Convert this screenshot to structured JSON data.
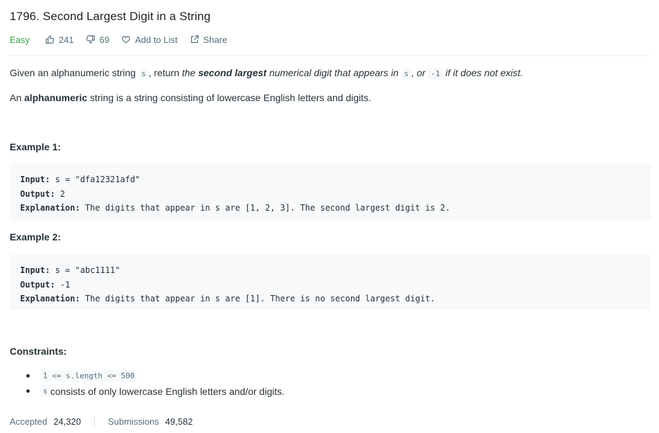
{
  "problem": {
    "title": "1796. Second Largest Digit in a String",
    "difficulty": "Easy",
    "likes": "241",
    "dislikes": "69",
    "add_to_list": "Add to List",
    "share": "Share"
  },
  "description": {
    "p1_a": "Given an alphanumeric string ",
    "p1_code_s": "s",
    "p1_b": ", return ",
    "p1_c": "the ",
    "p1_bold": "second largest",
    "p1_d": " numerical digit that appears in ",
    "p1_code_s2": "s",
    "p1_e": ", or ",
    "p1_code_neg": "-1",
    "p1_f": " if it does not exist.",
    "p2_a": "An ",
    "p2_bold": "alphanumeric",
    "p2_b": " string is a string consisting of lowercase English letters and digits."
  },
  "examples": [
    {
      "heading": "Example 1:",
      "input_label": "Input:",
      "input_value": " s = \"dfa12321afd\"",
      "output_label": "Output:",
      "output_value": " 2",
      "explanation_label": "Explanation:",
      "explanation_value": " The digits that appear in s are [1, 2, 3]. The second largest digit is 2."
    },
    {
      "heading": "Example 2:",
      "input_label": "Input:",
      "input_value": " s = \"abc1111\"",
      "output_label": "Output:",
      "output_value": " -1",
      "explanation_label": "Explanation:",
      "explanation_value": " The digits that appear in s are [1]. There is no second largest digit."
    }
  ],
  "constraints": {
    "heading": "Constraints:",
    "c1_code": "1 <= s.length <= 500",
    "c2_code": "s",
    "c2_text": " consists of only lowercase English letters and/or digits."
  },
  "stats": {
    "accepted_label": "Accepted",
    "accepted_value": "24,320",
    "submissions_label": "Submissions",
    "submissions_value": "49,582"
  },
  "icons": {
    "like": "thumbs-up-icon",
    "dislike": "thumbs-down-icon",
    "add": "heart-icon",
    "share": "share-icon"
  },
  "colors": {
    "easy": "#43a047",
    "code_bg": "#f7f9fa",
    "text": "#263238",
    "muted": "#546e7a"
  }
}
